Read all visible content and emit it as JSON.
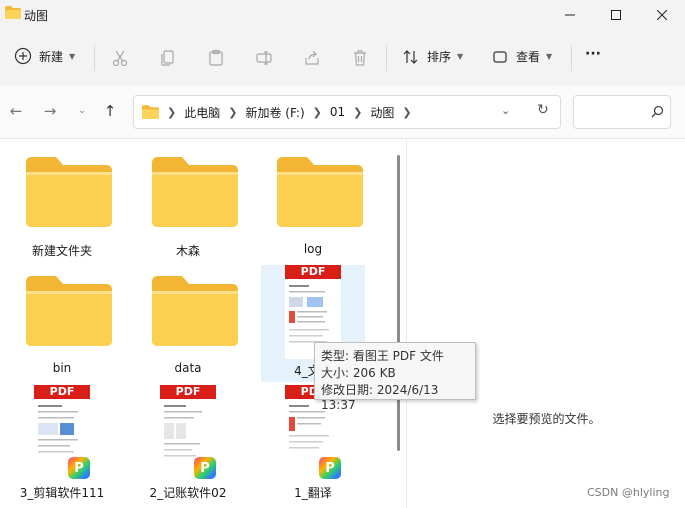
{
  "window": {
    "title": "动图"
  },
  "toolbar": {
    "new_label": "新建",
    "sort_label": "排序",
    "view_label": "查看",
    "more_label": "···"
  },
  "nav": {
    "breadcrumbs": [
      "此电脑",
      "新加卷 (F:)",
      "01",
      "动图"
    ]
  },
  "items": [
    {
      "name": "新建文件夹",
      "type": "folder"
    },
    {
      "name": "木森",
      "type": "folder"
    },
    {
      "name": "log",
      "type": "folder"
    },
    {
      "name": "bin",
      "type": "folder"
    },
    {
      "name": "data",
      "type": "folder"
    },
    {
      "name": "4_文件",
      "type": "pdf"
    },
    {
      "name": "3_剪辑软件111",
      "type": "pdf"
    },
    {
      "name": "2_记账软件02",
      "type": "pdf"
    },
    {
      "name": "1_翻译",
      "type": "pdf"
    }
  ],
  "pdf_banner": "PDF",
  "tooltip": {
    "type_line": "类型: 看图王 PDF 文件",
    "size_line": "大小: 206 KB",
    "date_line": "修改日期: 2024/6/13 13:37"
  },
  "preview_pane": {
    "message": "选择要预览的文件。"
  },
  "watermark": "CSDN @hlyling",
  "colors": {
    "folder": "#f9c33b",
    "pdf_banner": "#d91e18",
    "selection": "#e5f1fb"
  }
}
